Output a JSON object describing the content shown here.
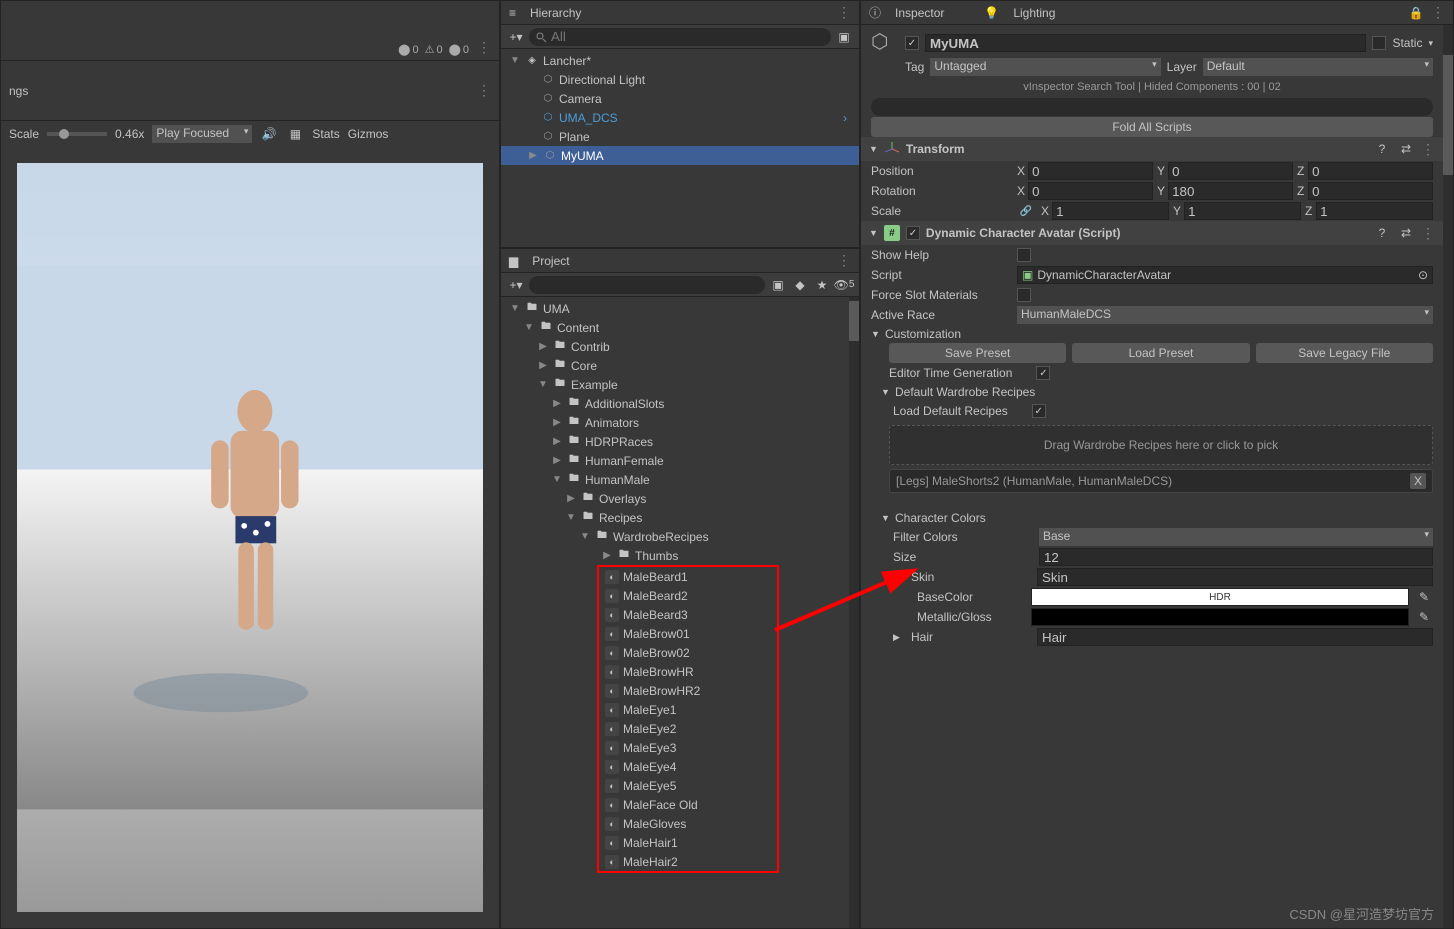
{
  "hierarchy": {
    "title": "Hierarchy",
    "search_placeholder": "All",
    "scene": "Lancher*",
    "items": [
      "Directional Light",
      "Camera",
      "UMA_DCS",
      "Plane",
      "MyUMA"
    ],
    "selected": "MyUMA",
    "highlighted": "UMA_DCS"
  },
  "project": {
    "title": "Project",
    "search_placeholder": "",
    "hidden_count": "5",
    "root": "UMA",
    "tree": {
      "content": "Content",
      "contrib": "Contrib",
      "core": "Core",
      "example": "Example",
      "additional_slots": "AdditionalSlots",
      "animators": "Animators",
      "hdrp": "HDRPRaces",
      "human_female": "HumanFemale",
      "human_male": "HumanMale",
      "overlays": "Overlays",
      "recipes": "Recipes",
      "wardrobe_recipes": "WardrobeRecipes",
      "thumbs": "Thumbs"
    },
    "assets": [
      "MaleBeard1",
      "MaleBeard2",
      "MaleBeard3",
      "MaleBrow01",
      "MaleBrow02",
      "MaleBrowHR",
      "MaleBrowHR2",
      "MaleEye1",
      "MaleEye2",
      "MaleEye3",
      "MaleEye4",
      "MaleEye5",
      "MaleFace Old",
      "MaleGloves",
      "MaleHair1",
      "MaleHair2"
    ]
  },
  "scene": {
    "ngs": "ngs",
    "scale_label": "Scale",
    "scale_value": "0.46x",
    "play_mode": "Play Focused",
    "stats": "Stats",
    "gizmos": "Gizmos",
    "errors0": "0",
    "warnings0": "0",
    "errors1": "0"
  },
  "inspector": {
    "title": "Inspector",
    "lighting": "Lighting",
    "object_name": "MyUMA",
    "static_label": "Static",
    "tag_label": "Tag",
    "tag_value": "Untagged",
    "layer_label": "Layer",
    "layer_value": "Default",
    "vinspector": "vInspector Search Tool | Hided Components : 00 | 02",
    "fold_all": "Fold All Scripts",
    "transform": {
      "title": "Transform",
      "position": "Position",
      "rotation": "Rotation",
      "scale": "Scale",
      "pos": {
        "x": "0",
        "y": "0",
        "z": "0"
      },
      "rot": {
        "x": "0",
        "y": "180",
        "z": "0"
      },
      "scl": {
        "x": "1",
        "y": "1",
        "z": "1"
      }
    },
    "dca": {
      "title": "Dynamic Character Avatar (Script)",
      "show_help": "Show Help",
      "script_label": "Script",
      "script_value": "DynamicCharacterAvatar",
      "force_slot": "Force Slot Materials",
      "active_race_label": "Active Race",
      "active_race_value": "HumanMaleDCS",
      "customization": "Customization",
      "save_preset": "Save Preset",
      "load_preset": "Load Preset",
      "save_legacy": "Save Legacy File",
      "editor_time": "Editor Time Generation",
      "default_wardrobe": "Default Wardrobe Recipes",
      "load_default": "Load Default Recipes",
      "drop_text": "Drag Wardrobe Recipes here or click to pick",
      "slot_item": "[Legs] MaleShorts2 (HumanMale, HumanMaleDCS)",
      "char_colors": "Character Colors",
      "filter_colors": "Filter Colors",
      "filter_value": "Base",
      "size_label": "Size",
      "size_value": "12",
      "skin": "Skin",
      "skin_val": "Skin",
      "base_color": "BaseColor",
      "hdr": "HDR",
      "metallic": "Metallic/Gloss",
      "hair": "Hair",
      "hair_val": "Hair"
    }
  },
  "watermark": "CSDN @星河造梦坊官方"
}
